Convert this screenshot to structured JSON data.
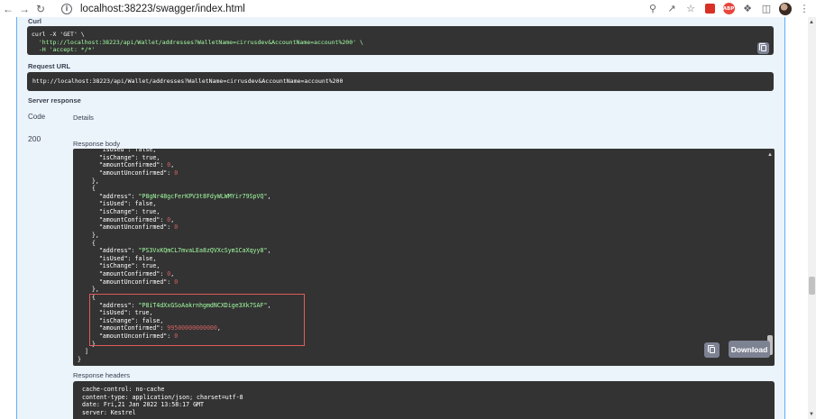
{
  "browser": {
    "url": "localhost:38223/swagger/index.html",
    "back_icon": "arrow-left",
    "forward_icon": "arrow-right",
    "reload_icon": "reload"
  },
  "curl": {
    "label": "Curl",
    "line1": "curl -X 'GET' \\",
    "line2": "  'http://localhost:38223/api/Wallet/addresses?WalletName=cirrusdev&AccountName=account%200' \\",
    "line3": "  -H 'accept: */*'"
  },
  "request_url": {
    "label": "Request URL",
    "value": "http://localhost:38223/api/Wallet/addresses?WalletName=cirrusdev&AccountName=account%200"
  },
  "server_response": {
    "label": "Server response",
    "col_code": "Code",
    "col_details": "Details",
    "status": "200",
    "body_label": "Response body",
    "headers_label": "Response headers",
    "download_label": "Download"
  },
  "response_body_lines": [
    "      \"isUsed\": false,",
    "      \"isChange\": true,",
    "      \"amountConfirmed\": 0,",
    "      \"amountUnconfirmed\": 0",
    "    },",
    "    {",
    "      \"address\": \"P8gNr48gcFerKPV3t8FdyWLWMYir79SpVQ\",",
    "      \"isUsed\": false,",
    "      \"isChange\": true,",
    "      \"amountConfirmed\": 0,",
    "      \"amountUnconfirmed\": 0",
    "    },",
    "    {",
    "      \"address\": \"PS3VxKQmCL7mvaLEa8zQVXcSym1CaXqyy8\",",
    "      \"isUsed\": false,",
    "      \"isChange\": true,",
    "      \"amountConfirmed\": 0,",
    "      \"amountUnconfirmed\": 0",
    "    },",
    "    {",
    "      \"address\": \"P8iT4dXxGSoAakrnhgmdNCXDige3Xk7SAF\",",
    "      \"isUsed\": true,",
    "      \"isChange\": false,",
    "      \"amountConfirmed\": 99500000000000,",
    "      \"amountUnconfirmed\": 0",
    "    }",
    "  ]",
    "}"
  ],
  "response_headers_lines": [
    "cache-control: no-cache",
    "content-type: application/json; charset=utf-8",
    "date: Fri,21 Jan 2022 13:58:17 GMT",
    "server: Kestrel"
  ],
  "colors": {
    "string": "#a2fca2",
    "number": "#d36363",
    "highlight_border": "#e05b5b",
    "panel_bg": "#ebf3fb",
    "panel_border": "#61affe",
    "code_bg": "#333333"
  }
}
